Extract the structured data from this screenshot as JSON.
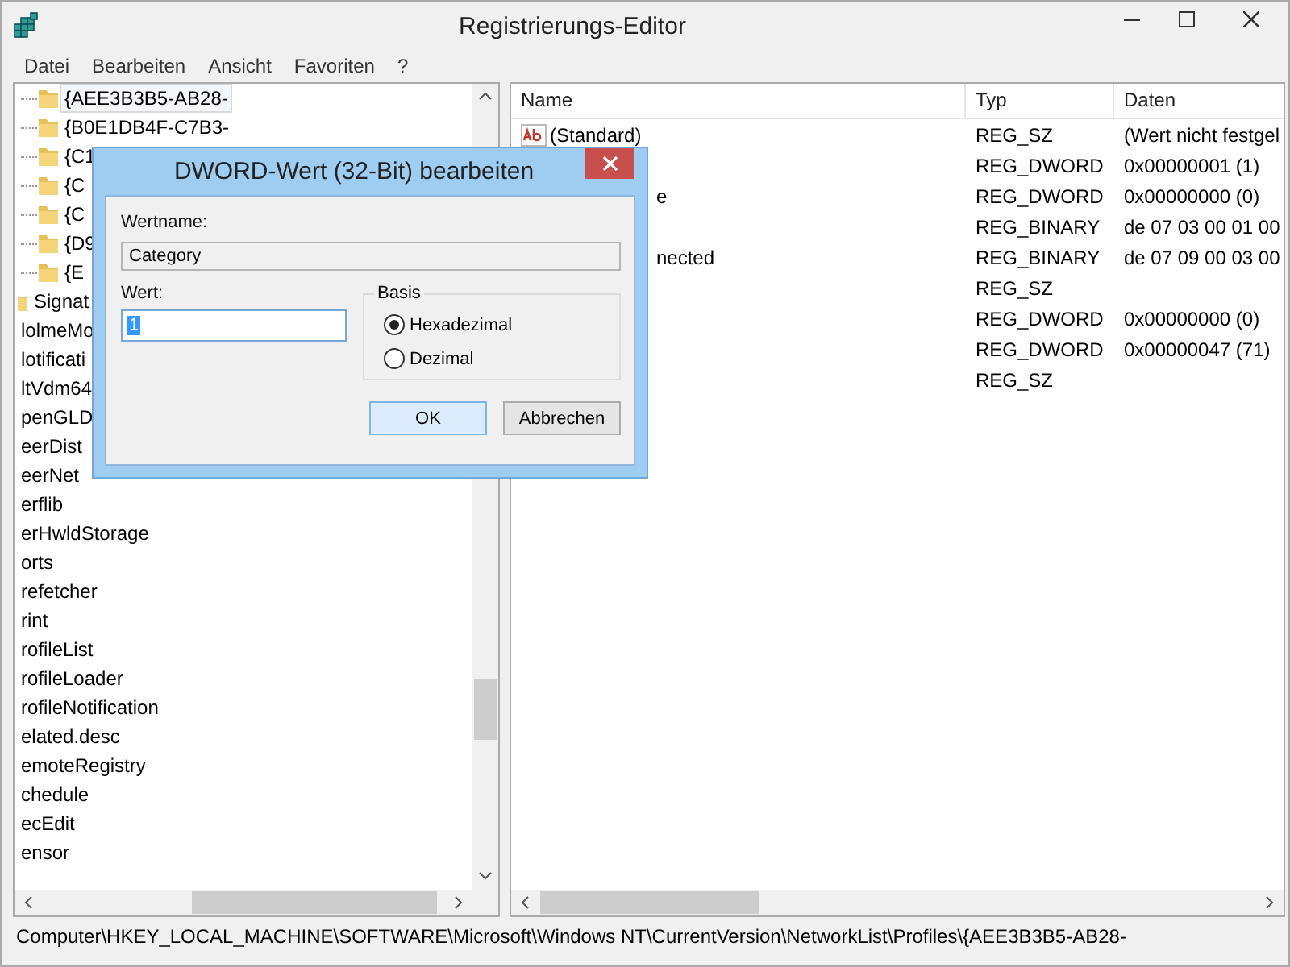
{
  "window": {
    "title": "Registrierungs-Editor"
  },
  "menu": [
    "Datei",
    "Bearbeiten",
    "Ansicht",
    "Favoriten",
    "?"
  ],
  "tree": {
    "sub_items": [
      {
        "label": "{AEE3B3B5-AB28-",
        "selected": true
      },
      {
        "label": "{B0E1DB4F-C7B3-",
        "selected": false
      },
      {
        "label": "{C1",
        "selected": false
      },
      {
        "label": "{C",
        "selected": false
      },
      {
        "label": "{C",
        "selected": false
      },
      {
        "label": "{D9",
        "selected": false
      },
      {
        "label": "{E",
        "selected": false
      }
    ],
    "items": [
      {
        "label": "Signat",
        "kind": "folder"
      },
      {
        "label": "lolmeMo",
        "kind": "plain"
      },
      {
        "label": "lotificati",
        "kind": "plain"
      },
      {
        "label": "ltVdm64",
        "kind": "plain"
      },
      {
        "label": "penGLD",
        "kind": "plain"
      },
      {
        "label": "eerDist",
        "kind": "plain"
      },
      {
        "label": "eerNet",
        "kind": "plain"
      },
      {
        "label": "erflib",
        "kind": "plain"
      },
      {
        "label": "erHwldStorage",
        "kind": "plain"
      },
      {
        "label": "orts",
        "kind": "plain"
      },
      {
        "label": "refetcher",
        "kind": "plain"
      },
      {
        "label": "rint",
        "kind": "plain"
      },
      {
        "label": "rofileList",
        "kind": "plain"
      },
      {
        "label": "rofileLoader",
        "kind": "plain"
      },
      {
        "label": "rofileNotification",
        "kind": "plain"
      },
      {
        "label": "elated.desc",
        "kind": "plain"
      },
      {
        "label": "emoteRegistry",
        "kind": "plain"
      },
      {
        "label": "chedule",
        "kind": "plain"
      },
      {
        "label": "ecEdit",
        "kind": "plain"
      },
      {
        "label": "ensor",
        "kind": "plain"
      }
    ]
  },
  "values": {
    "columns": [
      "Name",
      "Typ",
      "Daten"
    ],
    "rows": [
      {
        "name": "(Standard)",
        "icon_visible": true,
        "name_start_covered": false,
        "type": "REG_SZ",
        "data": "(Wert nicht festgel"
      },
      {
        "type": "REG_DWORD",
        "data": "0x00000001 (1)"
      },
      {
        "name": "e",
        "icon_visible": false,
        "name_start_covered": true,
        "type": "REG_DWORD",
        "data": "0x00000000 (0)"
      },
      {
        "type": "REG_BINARY",
        "data": "de 07 03 00 01 00"
      },
      {
        "name": "nected",
        "icon_visible": false,
        "name_start_covered": true,
        "type": "REG_BINARY",
        "data": "de 07 09 00 03 00"
      },
      {
        "type": "REG_SZ"
      },
      {
        "type": "REG_DWORD",
        "data": "0x00000000 (0)"
      },
      {
        "type": "REG_DWORD",
        "data": "0x00000047 (71)"
      },
      {
        "type": "REG_SZ"
      }
    ]
  },
  "status_bar": "Computer\\HKEY_LOCAL_MACHINE\\SOFTWARE\\Microsoft\\Windows NT\\CurrentVersion\\NetworkList\\Profiles\\{AEE3B3B5-AB28-",
  "dialog": {
    "title": "DWORD-Wert (32-Bit) bearbeiten",
    "name_label": "Wertname:",
    "name_value": "Category",
    "value_label": "Wert:",
    "value": "1",
    "base_label": "Basis",
    "bases": [
      {
        "label": "Hexadezimal",
        "selected": true
      },
      {
        "label": "Dezimal",
        "selected": false
      }
    ],
    "buttons": [
      {
        "label": "OK",
        "kind": "default"
      },
      {
        "label": "Abbrechen",
        "kind": "normal"
      }
    ]
  }
}
